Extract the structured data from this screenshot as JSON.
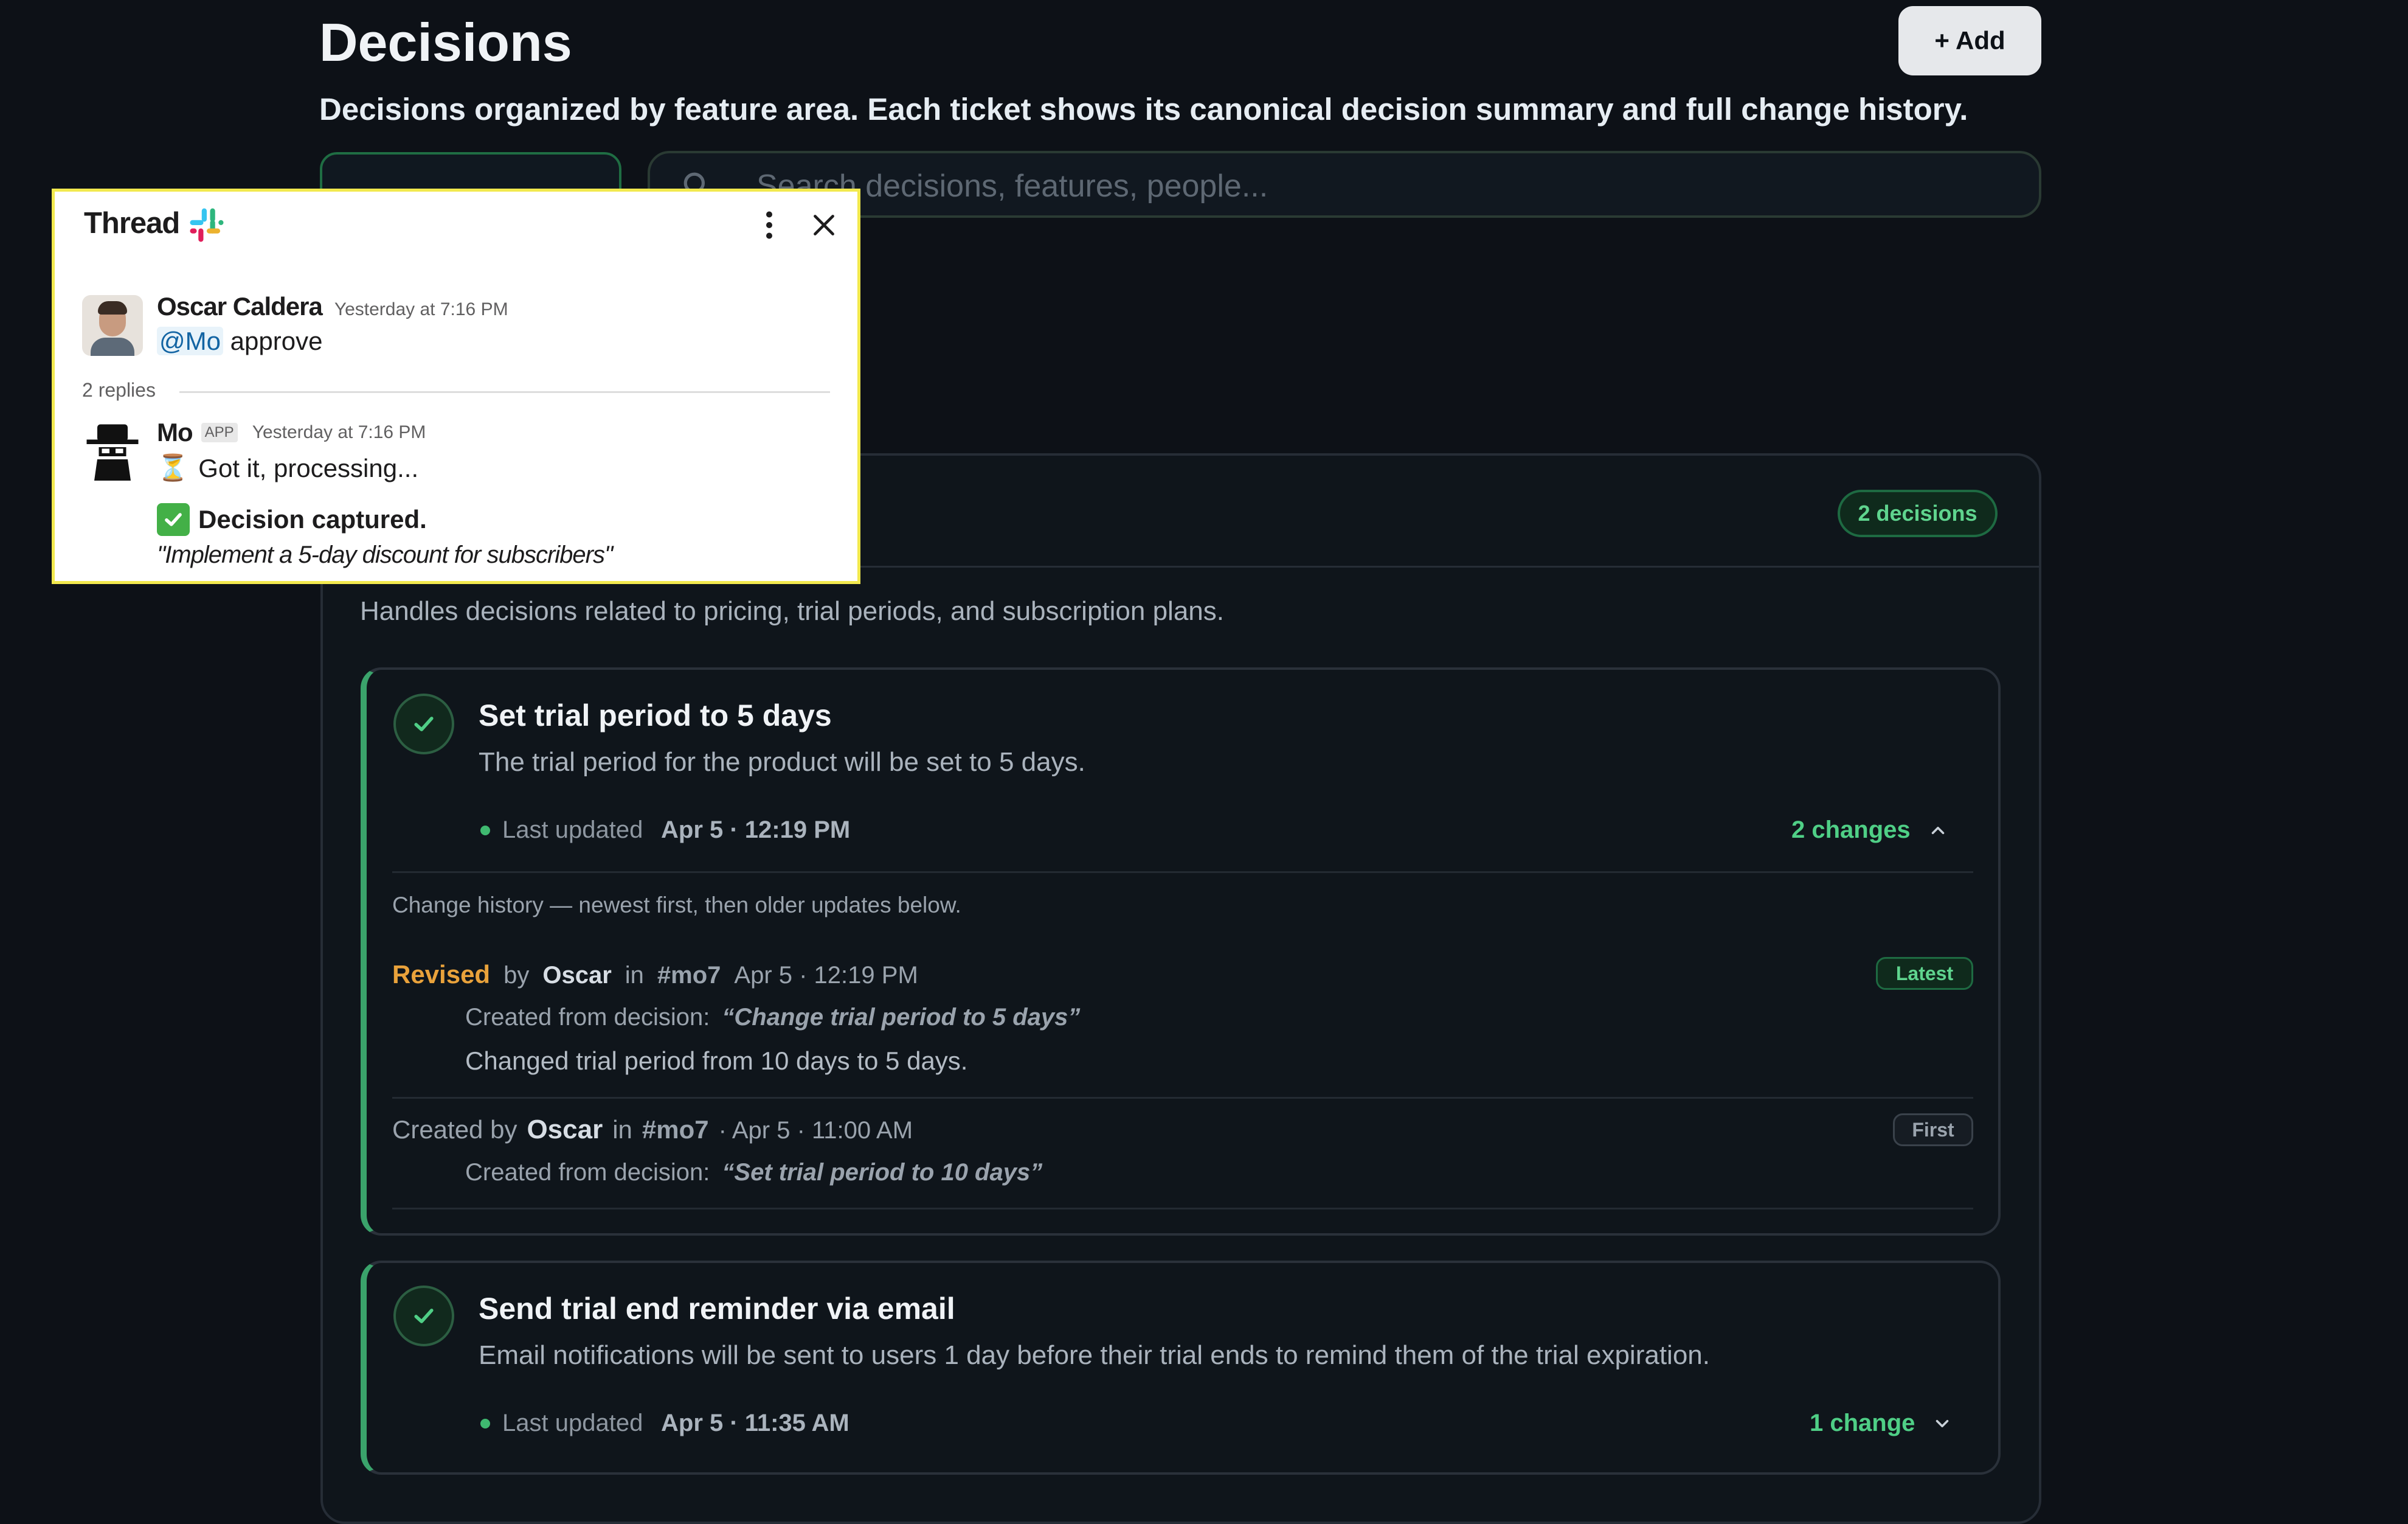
{
  "header": {
    "title": "Decisions",
    "add_label": "+ Add",
    "subtitle": "Decisions organized by feature area. Each ticket shows its canonical decision summary and full change history."
  },
  "search": {
    "placeholder": "Search decisions, features, people..."
  },
  "feature": {
    "badge": "2 decisions",
    "description": "Handles decisions related to pricing, trial periods, and subscription plans."
  },
  "decisions": [
    {
      "title": "Set trial period to 5 days",
      "description": "The trial period for the product will be set to 5 days.",
      "last_updated_label": "Last updated",
      "last_updated": "Apr 5 · 12:19 PM",
      "changes_label": "2 changes",
      "expanded": true,
      "history_intro": "Change history — newest first, then older updates below.",
      "history": [
        {
          "action": "Revised",
          "by_label": "by",
          "author": "Oscar",
          "in_label": "in",
          "channel": "#mo7",
          "time": "Apr 5 · 12:19 PM",
          "badge": "Latest",
          "source_label": "Created from decision:",
          "source_quote": "“Change trial period to 5 days”",
          "note": "Changed trial period from 10 days to 5 days."
        },
        {
          "action": "Created by",
          "author": "Oscar",
          "in_label": "in",
          "channel": "#mo7",
          "time": "· Apr 5 · 11:00 AM",
          "badge": "First",
          "source_label": "Created from decision:",
          "source_quote": "“Set trial period to 10 days”"
        }
      ]
    },
    {
      "title": "Send trial end reminder via email",
      "description": "Email notifications will be sent to users 1 day before their trial ends to remind them of the trial expiration.",
      "last_updated_label": "Last updated",
      "last_updated": "Apr 5 · 11:35 AM",
      "changes_label": "1 change",
      "expanded": false
    }
  ],
  "thread": {
    "title": "Thread",
    "parent": {
      "author": "Oscar Caldera",
      "time": "Yesterday at 7:16 PM",
      "mention": "@Mo",
      "text": "approve"
    },
    "replies_label": "2 replies",
    "reply": {
      "author": "Mo",
      "app_badge": "APP",
      "time": "Yesterday at 7:16 PM",
      "processing": "Got it, processing...",
      "captured": "Decision captured.",
      "quote": "\"Implement a 5-day discount for subscribers\""
    }
  },
  "colors": {
    "background": "#0d1117",
    "accent_green": "#4fcf86",
    "revised_orange": "#e9a23b",
    "popup_border": "#f2e94e"
  },
  "icons": [
    "search-icon",
    "check-icon",
    "chevron-up-icon",
    "chevron-down-icon",
    "kebab-menu-icon",
    "close-icon",
    "slack-logo-icon",
    "hourglass-icon",
    "check-mark-button-icon"
  ]
}
